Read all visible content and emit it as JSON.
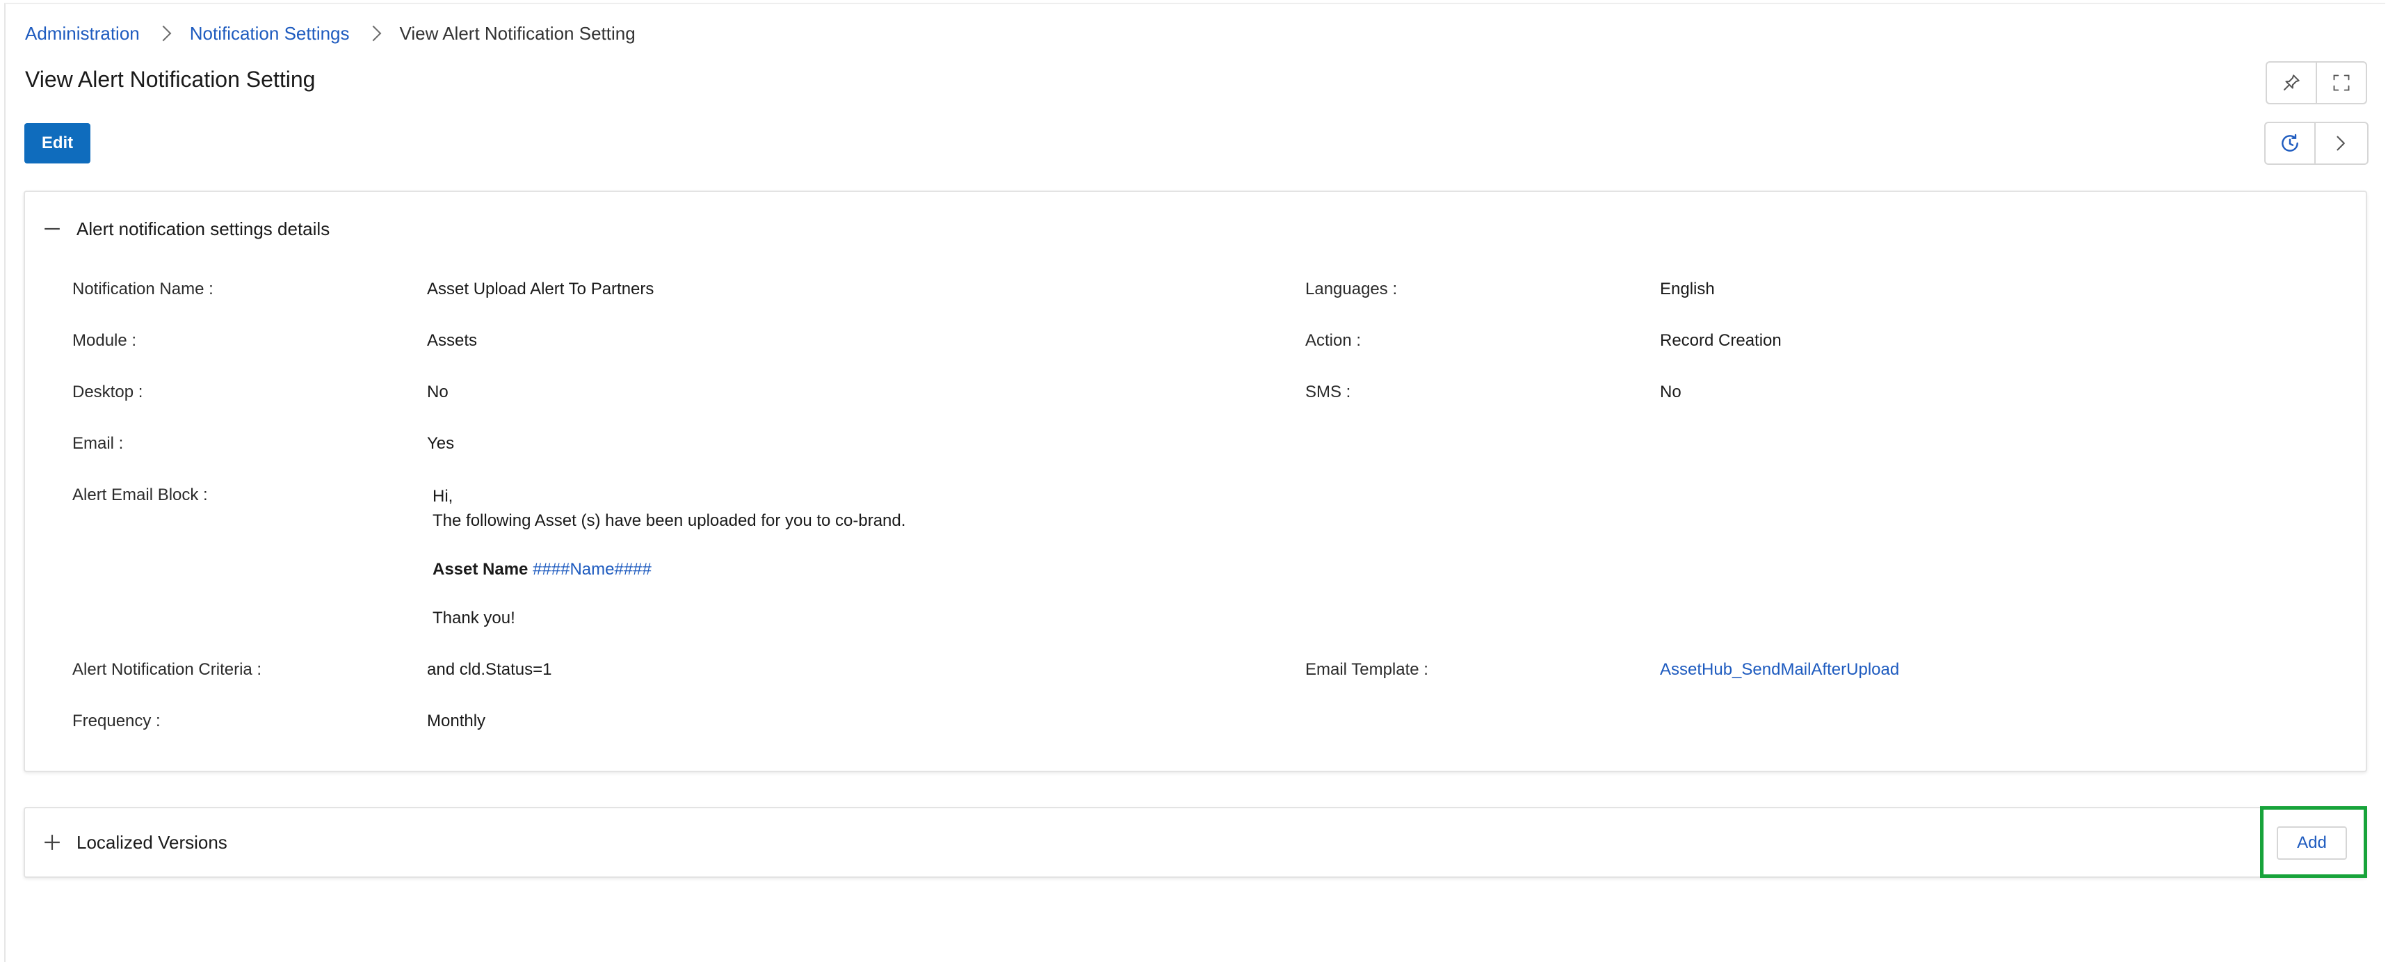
{
  "breadcrumb": {
    "items": [
      "Administration",
      "Notification Settings"
    ],
    "current": "View Alert Notification Setting"
  },
  "page": {
    "title": "View Alert Notification Setting",
    "edit_label": "Edit"
  },
  "toolbar": {
    "top_icons": [
      "pin-icon",
      "expand-icon"
    ],
    "bottom_icons": [
      "history-icon",
      "chevron-right-icon"
    ]
  },
  "details": {
    "section_title": "Alert notification settings details",
    "fields": {
      "notification_name": {
        "label": "Notification Name :",
        "value": "Asset Upload Alert To Partners"
      },
      "languages": {
        "label": "Languages :",
        "value": "English"
      },
      "module": {
        "label": "Module :",
        "value": "Assets"
      },
      "action": {
        "label": "Action :",
        "value": "Record Creation"
      },
      "desktop": {
        "label": "Desktop :",
        "value": "No"
      },
      "sms": {
        "label": "SMS :",
        "value": "No"
      },
      "email": {
        "label": "Email :",
        "value": "Yes"
      },
      "alert_email_block": {
        "label": "Alert Email Block :"
      },
      "criteria": {
        "label": "Alert Notification Criteria :",
        "value": "and cld.Status=1"
      },
      "email_template": {
        "label": "Email Template :",
        "value": "AssetHub_SendMailAfterUpload"
      },
      "frequency": {
        "label": "Frequency :",
        "value": "Monthly"
      }
    },
    "email_block": {
      "greeting": "Hi,",
      "body": "The following Asset (s) have been uploaded for you to co-brand.",
      "asset_label": "Asset Name",
      "asset_var": "####Name####",
      "closing": "Thank you!"
    }
  },
  "localized": {
    "section_title": "Localized Versions",
    "add_label": "Add"
  },
  "colors": {
    "primary": "#0f6cbd",
    "link": "#1e5bbf",
    "highlight": "#17a33a"
  }
}
